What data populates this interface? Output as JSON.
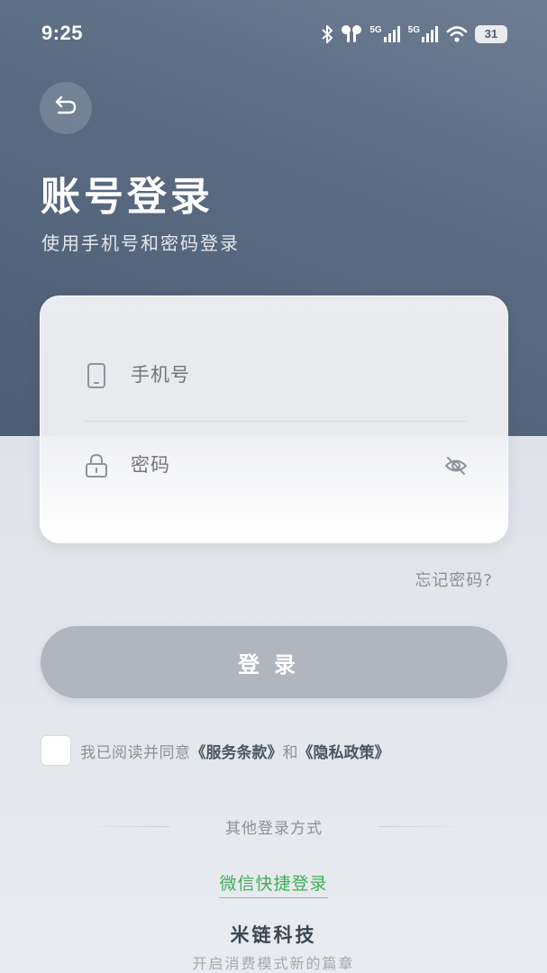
{
  "status_bar": {
    "time": "9:25",
    "battery": "31",
    "icons": [
      "bluetooth-icon",
      "earbuds-icon",
      "signal-5g-icon",
      "signal-5g-icon",
      "wifi-icon",
      "battery-icon"
    ],
    "network_label_1": "5G",
    "network_label_2": "5G"
  },
  "header": {
    "back_icon": "return-arrow-icon",
    "title": "账号登录",
    "subtitle": "使用手机号和密码登录"
  },
  "form": {
    "phone_placeholder": "手机号",
    "phone_icon": "phone-icon",
    "password_placeholder": "密码",
    "password_icon": "lock-icon",
    "visibility_icon": "eye-off-icon"
  },
  "forgot_password": "忘记密码?",
  "login_button": "登录",
  "agreement": {
    "checked": false,
    "prefix": "我已阅读并同意",
    "terms": "《服务条款》",
    "and": "和",
    "privacy": "《隐私政策》"
  },
  "other_login": {
    "label": "其他登录方式",
    "wechat": "微信快捷登录"
  },
  "footer": {
    "brand": "米链科技",
    "slogan": "开启消费模式新的篇章"
  },
  "colors": {
    "hero": "#5a6b82",
    "login_button": "#b1b5bd",
    "wechat_green": "#3fae5a"
  }
}
